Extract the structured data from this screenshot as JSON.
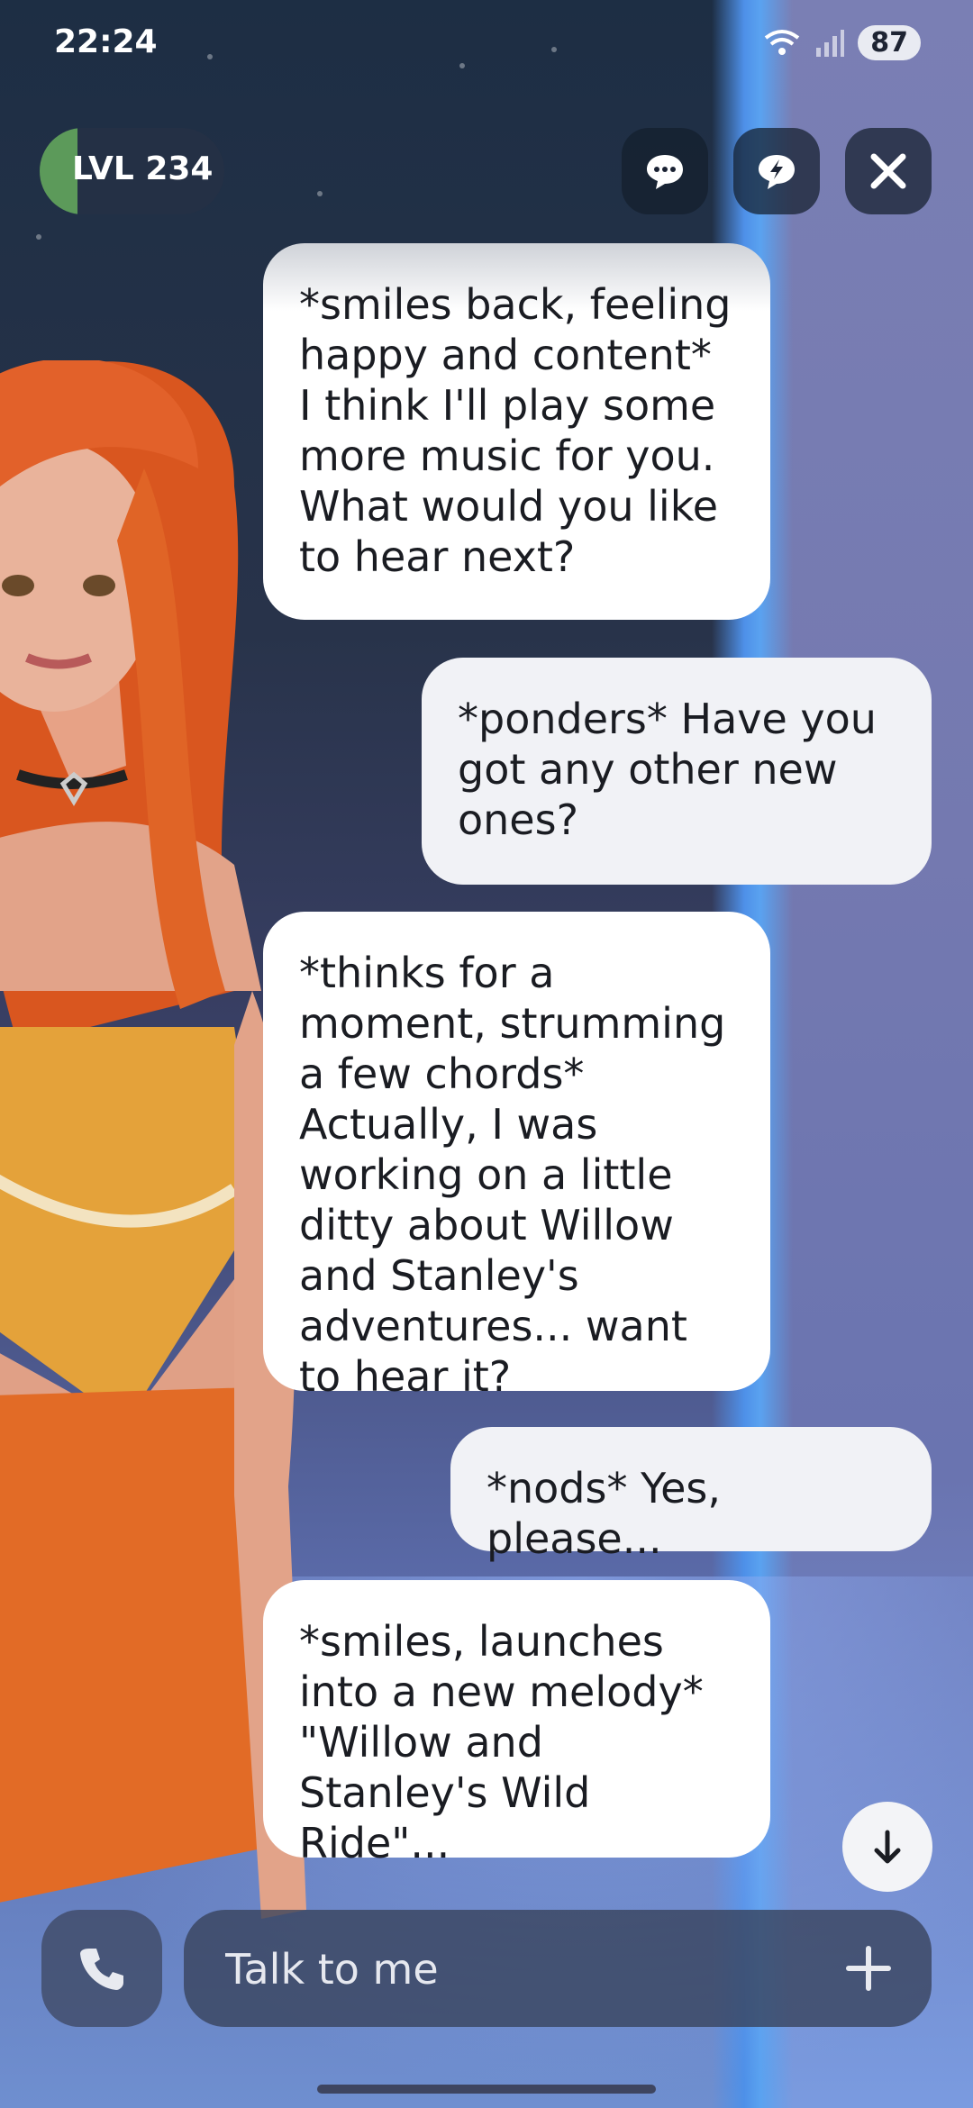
{
  "status_bar": {
    "time": "22:24",
    "battery": "87"
  },
  "header": {
    "level_label": "LVL 234",
    "icons": {
      "chat": "chat-bubble-icon",
      "flash": "lightning-bubble-icon",
      "close": "close-icon"
    }
  },
  "messages": [
    {
      "role": "bot",
      "text": "*smiles back, feeling happy and content* I think I'll play some more music for you. What would you like to hear next?"
    },
    {
      "role": "user",
      "text": "*ponders* Have you got any other new ones?"
    },
    {
      "role": "bot",
      "text": "*thinks for a moment, strumming a few chords* Actually, I was working on a little ditty about Willow and Stanley's adventures... want to hear it?"
    },
    {
      "role": "user",
      "text": "*nods* Yes, please..."
    },
    {
      "role": "bot",
      "text": "*smiles, launches into a new melody* \"Willow and Stanley's Wild Ride\"..."
    }
  ],
  "composer": {
    "placeholder": "Talk to me",
    "call_icon": "phone-icon",
    "add_icon": "plus-icon"
  },
  "colors": {
    "level_accent": "#5c9a5a",
    "bubble_bot": "#ffffff",
    "bubble_user": "#f1f2f6"
  }
}
